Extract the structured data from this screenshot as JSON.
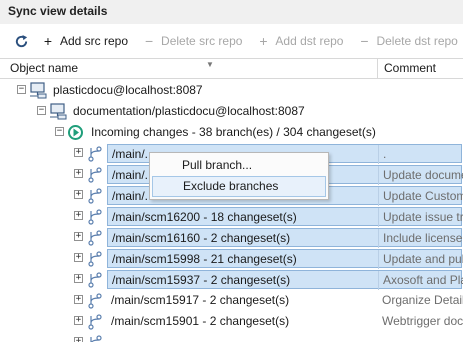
{
  "window": {
    "title": "Sync view details"
  },
  "toolbar": {
    "refresh_icon": "refresh-icon",
    "buttons": [
      {
        "label": "Add src repo",
        "icon": "plus-icon",
        "enabled": true
      },
      {
        "label": "Delete src repo",
        "icon": "minus-icon",
        "enabled": false
      },
      {
        "label": "Add dst repo",
        "icon": "plus-icon",
        "enabled": false
      },
      {
        "label": "Delete dst repo",
        "icon": "minus-icon",
        "enabled": false
      }
    ]
  },
  "columns": {
    "object_name": "Object name",
    "comment": "Comment"
  },
  "tree": {
    "server": "plasticdocu@localhost:8087",
    "repository": "documentation/plasticdocu@localhost:8087",
    "incoming": "Incoming changes - 38 branch(es) / 304 changeset(s)",
    "branches": [
      {
        "name": "/main/...",
        "comment": ".",
        "selected": true
      },
      {
        "name": "/main/...",
        "comment": "Update docume",
        "selected": true
      },
      {
        "name": "/main/...",
        "comment": "Update Custom",
        "selected": true
      },
      {
        "name": "/main/scm16200 - 18 changeset(s)",
        "comment": "Update issue tra",
        "selected": true
      },
      {
        "name": "/main/scm16160 - 2 changeset(s)",
        "comment": "Include license",
        "selected": true
      },
      {
        "name": "/main/scm15998 - 21 changeset(s)",
        "comment": "Update and pub",
        "selected": true
      },
      {
        "name": "/main/scm15937 - 2 changeset(s)",
        "comment": "Axosoft and Pla",
        "selected": true
      },
      {
        "name": "/main/scm15917 - 2 changeset(s)",
        "comment": "Organize Detail",
        "selected": false
      },
      {
        "name": "/main/scm15901 - 2 changeset(s)",
        "comment": "Webtrigger doc",
        "selected": false
      }
    ]
  },
  "context_menu": {
    "items": [
      {
        "label": "Pull branch..."
      },
      {
        "label": "Exclude branches"
      }
    ]
  },
  "colors": {
    "selection": "#cfe3f6",
    "selection_border": "#8fb4da",
    "incoming_icon": "#1f9e7a"
  }
}
